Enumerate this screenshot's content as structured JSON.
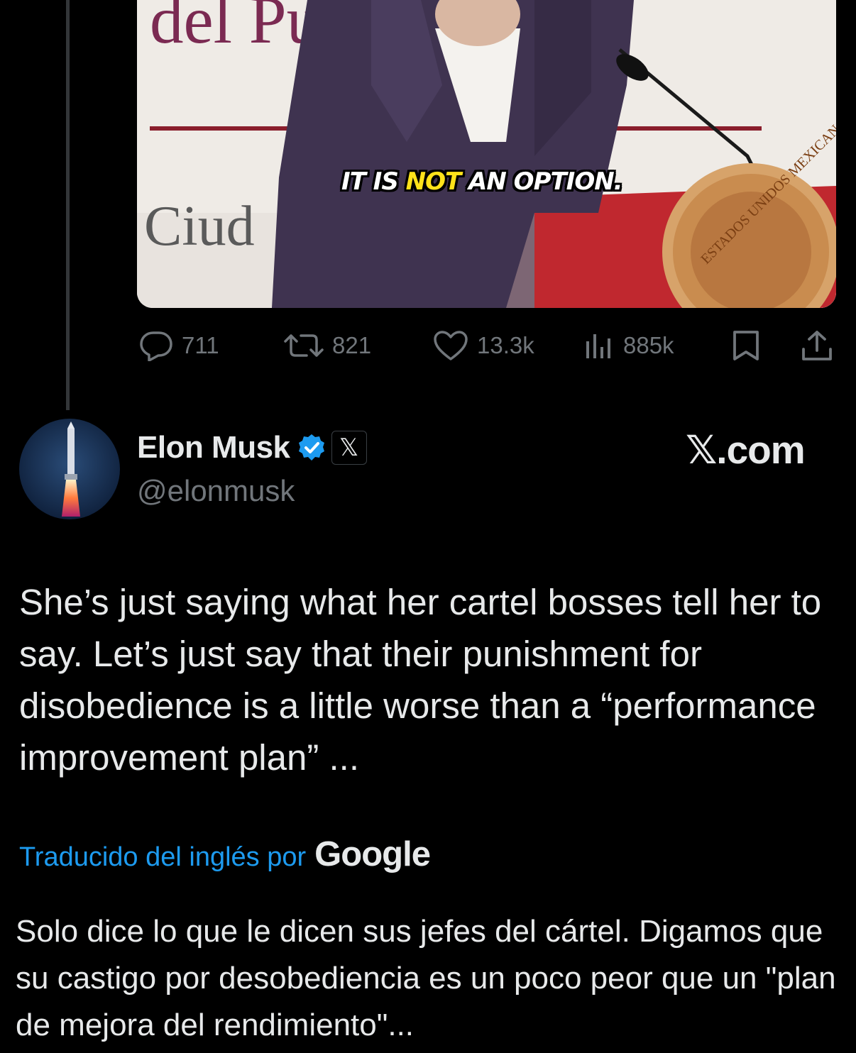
{
  "video": {
    "caption_before": "IT IS ",
    "caption_highlight": "NOT",
    "caption_after": " AN OPTION.",
    "backdrop_text_top": "del Pueblo",
    "backdrop_text_left": "Ciud",
    "seal_text": "ESTADOS UNIDOS MEXICANOS",
    "mute_icon": "volume-muted-icon"
  },
  "actions": {
    "replies": "711",
    "reposts": "821",
    "likes": "13.3k",
    "views": "885k",
    "icons": [
      "reply-icon",
      "repost-icon",
      "like-icon",
      "views-icon",
      "bookmark-icon",
      "share-icon"
    ]
  },
  "author": {
    "name": "Elon Musk",
    "handle": "@elonmusk",
    "affiliation_badge": "𝕏",
    "verified_color": "#1d9bf0"
  },
  "watermark": "𝕏.com",
  "tweet": {
    "text": "She’s just saying what her cartel bosses tell her to say. Let’s just say that their punishment for disobedience is a little worse than a “performance improvement plan” ..."
  },
  "translation": {
    "label": "Traducido del inglés por",
    "provider": "Google",
    "text": "Solo dice lo que le dicen sus jefes del cártel. Digamos que su castigo por desobediencia es un poco peor que un \"plan de mejora del rendimiento\"..."
  },
  "colors": {
    "background": "#000000",
    "text": "#e7e9ea",
    "muted": "#71767b",
    "accent": "#1d9bf0"
  }
}
